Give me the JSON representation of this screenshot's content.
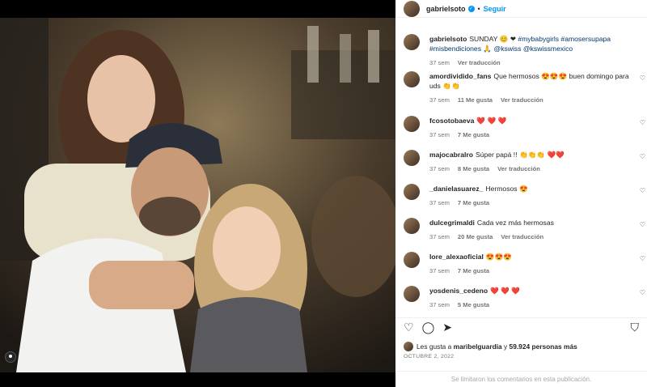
{
  "post": {
    "username": "gabrielsoto",
    "verified_mark": "✓",
    "follow_label": "Seguir",
    "separator": "•"
  },
  "caption": {
    "username": "gabrielsoto",
    "text": "SUNDAY 😊 ❤",
    "tags": "#mybabygirls #amosersupapa #misbendiciones 🙏 @kswiss @kswissmexico",
    "time": "37 sem",
    "translate": "Ver traducción"
  },
  "comments": [
    {
      "user": "amordividido_fans",
      "text": "Que hermosos 😍😍😍 buen domingo para uds 👏👏",
      "time": "37 sem",
      "likes": "11 Me gusta",
      "translate": "Ver traducción"
    },
    {
      "user": "fcosotobaeva",
      "text": "❤️ ❤️ ❤️",
      "time": "37 sem",
      "likes": "7 Me gusta",
      "translate": ""
    },
    {
      "user": "majocabralro",
      "text": "Súper papá !! 👏👏👏 ❤️❤️",
      "time": "37 sem",
      "likes": "8 Me gusta",
      "translate": "Ver traducción"
    },
    {
      "user": "_danielasuarez_",
      "text": "Hermosos 😍",
      "time": "37 sem",
      "likes": "7 Me gusta",
      "translate": ""
    },
    {
      "user": "dulcegrimaldi",
      "text": "Cada vez más hermosas",
      "time": "37 sem",
      "likes": "20 Me gusta",
      "translate": "Ver traducción"
    },
    {
      "user": "lore_alexaoficial",
      "text": "😍😍😍",
      "time": "37 sem",
      "likes": "7 Me gusta",
      "translate": ""
    },
    {
      "user": "yosdenis_cedeno",
      "text": "❤️ ❤️ ❤️",
      "time": "37 sem",
      "likes": "5 Me gusta",
      "translate": ""
    }
  ],
  "actions": {
    "like_icon": "heart-outline-icon",
    "comment_icon": "comment-icon",
    "share_icon": "send-icon",
    "save_icon": "bookmark-icon"
  },
  "likes": {
    "prefix": "Les gusta a",
    "user": "maribelguardia",
    "middle": "y",
    "count": "59.924 personas más"
  },
  "date": "OCTUBRE 2, 2022",
  "comments_limited": "Se limitaron los comentarios en esta publicación.",
  "colors": {
    "accent": "#0095f6",
    "text": "#262626",
    "muted": "#737373"
  }
}
